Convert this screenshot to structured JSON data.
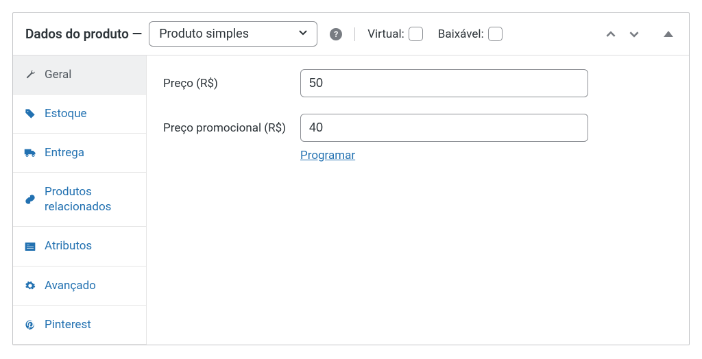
{
  "header": {
    "title": "Dados do produto —",
    "product_type": "Produto simples",
    "virtual_label": "Virtual:",
    "downloadable_label": "Baixável:"
  },
  "sidebar": {
    "items": [
      {
        "label": "Geral"
      },
      {
        "label": "Estoque"
      },
      {
        "label": "Entrega"
      },
      {
        "label": "Produtos relacionados"
      },
      {
        "label": "Atributos"
      },
      {
        "label": "Avançado"
      },
      {
        "label": "Pinterest"
      }
    ]
  },
  "fields": {
    "price_label": "Preço (R$)",
    "price_value": "50",
    "sale_price_label": "Preço promocional (R$)",
    "sale_price_value": "40",
    "schedule_link": "Programar"
  }
}
